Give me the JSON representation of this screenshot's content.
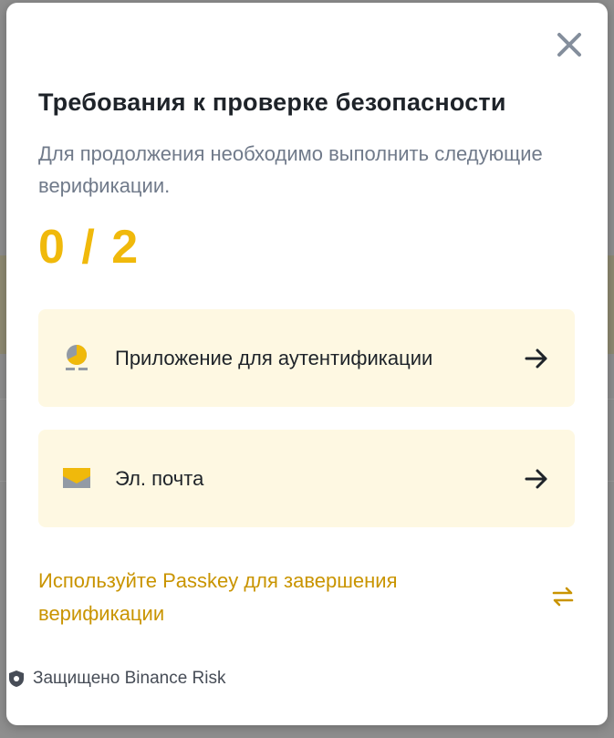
{
  "dialog": {
    "title": "Требования к проверке безопасности",
    "subtitle": "Для продолжения необходимо выполнить следующие верификации.",
    "progress": "0 / 2",
    "progress_done": 0,
    "progress_total": 2,
    "close_icon": "close-icon"
  },
  "methods": [
    {
      "label": "Приложение для аутентификации",
      "icon": "authenticator-icon"
    },
    {
      "label": "Эл. почта",
      "icon": "email-icon"
    }
  ],
  "passkey": {
    "label": "Используйте Passkey для завершения верификации",
    "icon": "swap-icon"
  },
  "footer": {
    "label": "Защищено Binance Risk",
    "icon": "shield-icon"
  },
  "colors": {
    "accent": "#F0B90B",
    "link": "#C99400",
    "card_bg": "#FEF8E2",
    "text_primary": "#1E2329",
    "text_secondary": "#707A8A"
  }
}
